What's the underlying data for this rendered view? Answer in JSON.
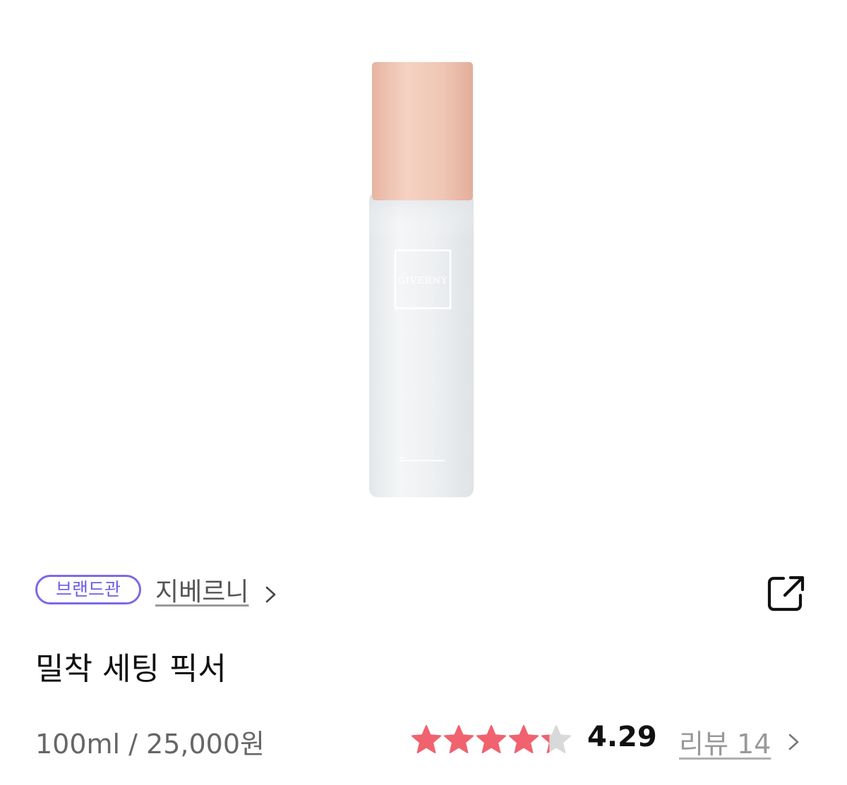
{
  "product": {
    "image_icon": "setting-fixer-bottle-image",
    "bottle_label": "GIVERNY",
    "brand_badge": "브랜드관",
    "brand_name": "지베르니",
    "name": "밀착 세팅 픽서",
    "volume_price": "100ml / 25,000원"
  },
  "rating": {
    "value": "4.29",
    "score": 4.29,
    "max": 5,
    "star_color": "#f0626e",
    "empty_star_color": "#d9d9d9"
  },
  "reviews": {
    "label": "리뷰 14"
  },
  "colors": {
    "brand_accent": "#6c5ce7",
    "cap": "#efc4b1"
  }
}
